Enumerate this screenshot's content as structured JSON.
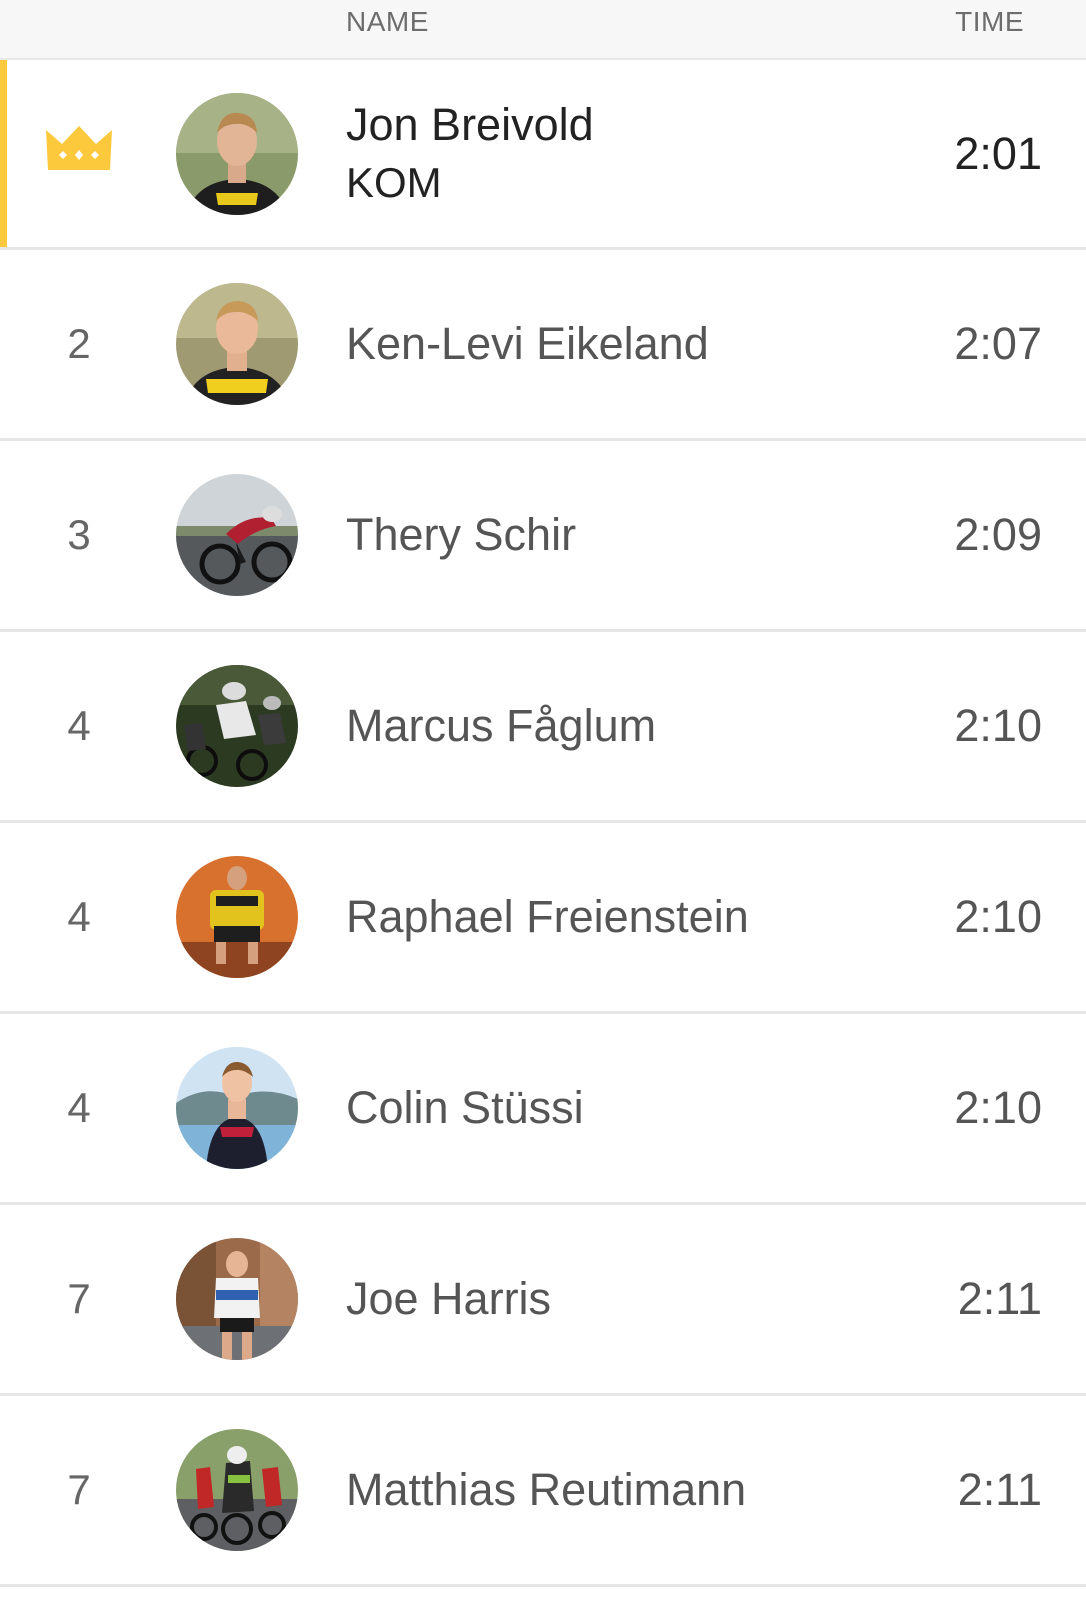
{
  "header": {
    "name_label": "NAME",
    "time_label": "TIME"
  },
  "colors": {
    "leader_accent": "#fcc83c",
    "crown": "#fcc83c",
    "divider": "#e6e6e6"
  },
  "leader": {
    "icon": "crown-icon",
    "name": "Jon Breivold",
    "title": "KOM",
    "time": "2:01"
  },
  "rows": [
    {
      "rank": "2",
      "name": "Ken-Levi Eikeland",
      "time": "2:07"
    },
    {
      "rank": "3",
      "name": "Thery Schir",
      "time": "2:09"
    },
    {
      "rank": "4",
      "name": "Marcus Fåglum",
      "time": "2:10"
    },
    {
      "rank": "4",
      "name": "Raphael Freienstein",
      "time": "2:10"
    },
    {
      "rank": "4",
      "name": "Colin Stüssi",
      "time": "2:10"
    },
    {
      "rank": "7",
      "name": "Joe Harris",
      "time": "2:11"
    },
    {
      "rank": "7",
      "name": "Matthias Reutimann",
      "time": "2:11"
    }
  ]
}
